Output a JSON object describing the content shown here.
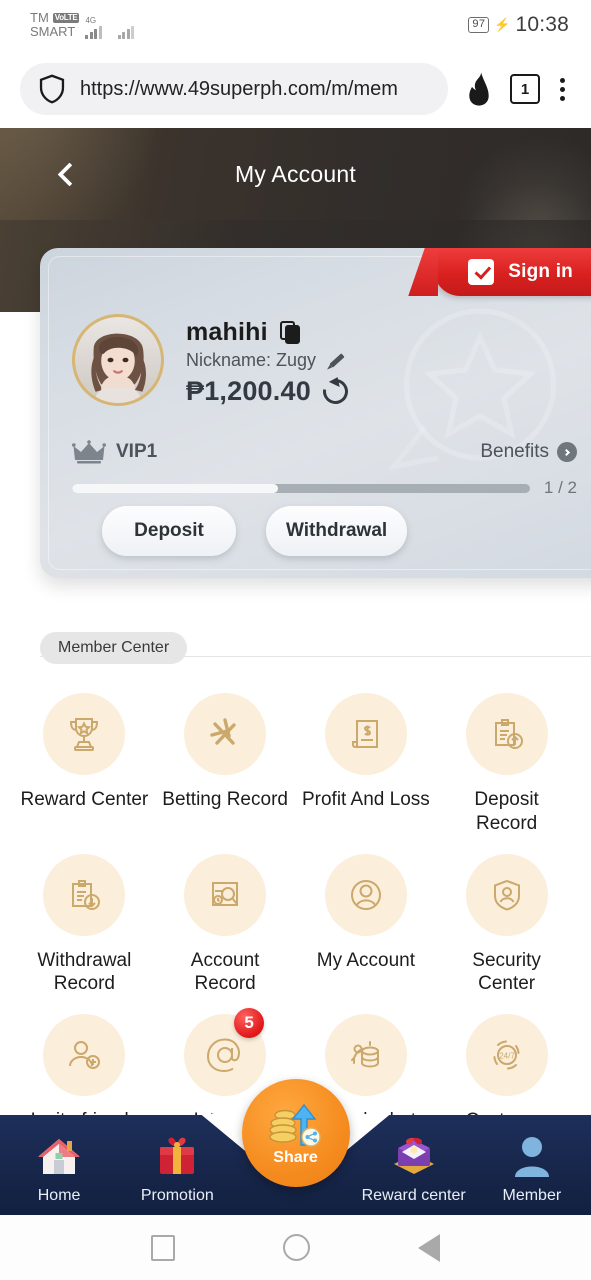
{
  "statusbar": {
    "carrier_top": "TM",
    "volte": "VoLTE",
    "carrier_bottom": "SMART",
    "network": "4G",
    "battery": "97",
    "time": "10:38"
  },
  "browser": {
    "url": "https://www.49superph.com/m/mem",
    "tab_count": "1"
  },
  "app_header": {
    "title": "My Account"
  },
  "account_card": {
    "signin_label": "Sign in",
    "username": "mahihi",
    "nickname": "Nickname: Zugy",
    "balance": "₱1,200.40",
    "vip_level": "VIP1",
    "benefits_label": "Benefits",
    "progress_count": "1 / 2",
    "progress_percent": 45,
    "deposit_label": "Deposit",
    "withdrawal_label": "Withdrawal"
  },
  "member_center": {
    "tab_label": "Member Center",
    "items": [
      {
        "label": "Reward Center",
        "icon": "trophy-icon"
      },
      {
        "label": "Betting Record",
        "icon": "betting-sticks-icon"
      },
      {
        "label": "Profit And Loss",
        "icon": "receipt-dollar-icon"
      },
      {
        "label": "Deposit Record",
        "icon": "clipboard-up-icon"
      },
      {
        "label": "Withdrawal Record",
        "icon": "clipboard-down-icon"
      },
      {
        "label": "Account Record",
        "icon": "record-search-icon"
      },
      {
        "label": "My Account",
        "icon": "user-circle-icon"
      },
      {
        "label": "Security Center",
        "icon": "shield-user-icon"
      },
      {
        "label": "Invite friends",
        "icon": "user-add-icon"
      },
      {
        "label": "Internal Message",
        "icon": "at-sign-icon",
        "badge": "5"
      },
      {
        "label": "Manual rebate",
        "icon": "coins-rebate-icon"
      },
      {
        "label": "Customer Service",
        "icon": "support-247-icon"
      }
    ]
  },
  "bottom_nav": {
    "items": [
      {
        "label": "Home",
        "icon": "house-icon"
      },
      {
        "label": "Promotion",
        "icon": "gift-box-icon"
      },
      {
        "label": "Share",
        "icon": "share-coins-icon"
      },
      {
        "label": "Reward center",
        "icon": "treasure-gift-icon"
      },
      {
        "label": "Member",
        "icon": "person-icon"
      }
    ]
  },
  "colors": {
    "accent_red": "#d92020",
    "gold": "#c9a96a",
    "icon_bg": "#fbeedb",
    "nav_bg": "#17264a",
    "share_orange": "#f58c20"
  }
}
